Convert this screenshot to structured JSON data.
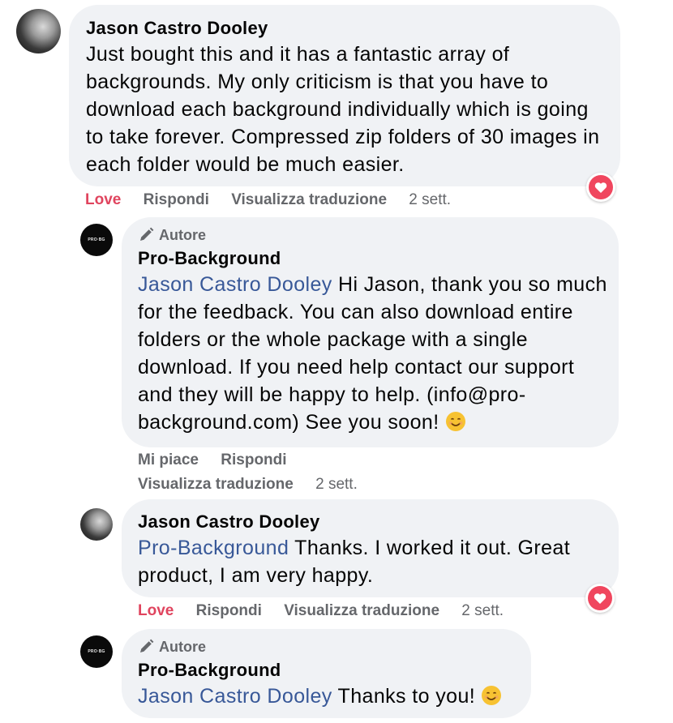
{
  "comments": [
    {
      "author": "Jason Castro Dooley",
      "text": "Just bought this and it has a fantastic array of backgrounds. My only criticism is that you have to download each background individually which is going to take forever. Compressed zip folders of 30 images in each folder would be much easier.",
      "actions": {
        "reaction": "Love",
        "reply": "Rispondi",
        "translate": "Visualizza traduzione",
        "time": "2 sett."
      },
      "reaction_icon": "heart-icon"
    },
    {
      "badge": "Autore",
      "author": "Pro-Background",
      "mention": "Jason Castro Dooley",
      "text": " Hi Jason, thank you so much for the feedback. You can also download entire folders or the whole package with a single download. If you need help contact our support and they will be happy to help. (info@pro-background.com) See you soon! ",
      "actions": {
        "like": "Mi piace",
        "reply": "Rispondi",
        "translate": "Visualizza traduzione",
        "time": "2 sett."
      }
    },
    {
      "author": "Jason Castro Dooley",
      "mention": "Pro-Background",
      "text": " Thanks. I worked it out. Great product, I am very happy.",
      "actions": {
        "reaction": "Love",
        "reply": "Rispondi",
        "translate": "Visualizza traduzione",
        "time": "2 sett."
      },
      "reaction_icon": "heart-icon"
    },
    {
      "badge": "Autore",
      "author": "Pro-Background",
      "mention": "Jason Castro Dooley",
      "text": " Thanks to you! "
    }
  ],
  "colors": {
    "bubble": "#f0f2f5",
    "mention": "#385898",
    "love": "#e0445e",
    "muted": "#65676b"
  },
  "icons": {
    "author_badge": "pencil-icon",
    "emoji": "smiling-face-emoji"
  }
}
